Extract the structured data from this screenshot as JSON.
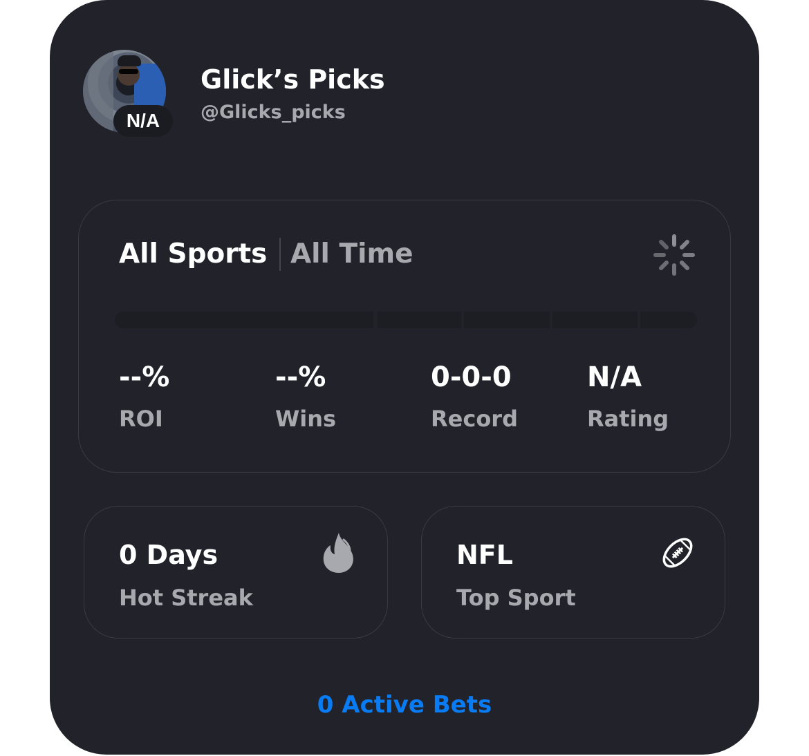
{
  "profile": {
    "name": "Glick’s Picks",
    "handle": "@Glicks_picks",
    "rating_badge": "N/A"
  },
  "filters": {
    "sport": "All Sports",
    "time": "All Time"
  },
  "stats": [
    {
      "value": "--%",
      "label": "ROI"
    },
    {
      "value": "--%",
      "label": "Wins"
    },
    {
      "value": "0-0-0",
      "label": "Record"
    },
    {
      "value": "N/A",
      "label": "Rating"
    }
  ],
  "hot_streak": {
    "value": "0 Days",
    "label": "Hot Streak",
    "icon": "flame-icon"
  },
  "top_sport": {
    "value": "NFL",
    "label": "Top Sport",
    "icon": "football-icon"
  },
  "active_bets": {
    "label": "0 Active Bets"
  },
  "colors": {
    "card_bg": "#22232a",
    "accent": "#0a7cf3",
    "muted_text": "#a8a9ae",
    "primary_text": "#ffffff"
  }
}
